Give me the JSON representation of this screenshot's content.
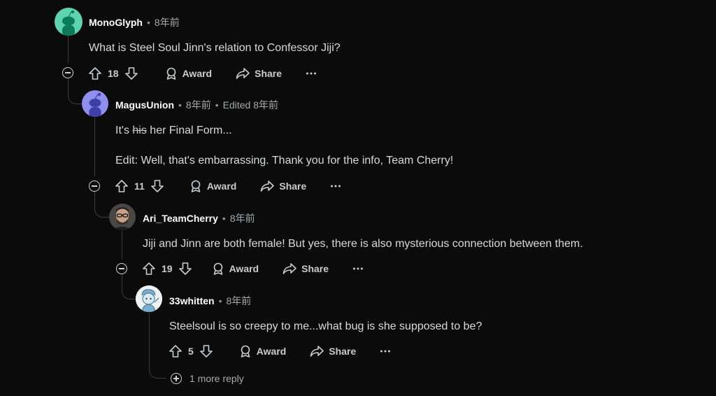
{
  "comments": [
    {
      "username": "MonoGlyph",
      "time": "8年前",
      "body": "What is Steel Soul Jinn's relation to Confessor Jiji?",
      "votes": "18",
      "award_label": "Award",
      "share_label": "Share"
    },
    {
      "username": "MagusUnion",
      "time": "8年前",
      "edited": "Edited 8年前",
      "body_prefix": "It's ",
      "body_strike": "his",
      "body_suffix": " her Final Form...",
      "body_edit": "Edit: Well, that's embarrassing. Thank you for the info, Team Cherry!",
      "votes": "11",
      "award_label": "Award",
      "share_label": "Share"
    },
    {
      "username": "Ari_TeamCherry",
      "time": "8年前",
      "body": "Jiji and Jinn are both female! But yes, there is also mysterious connection between them.",
      "votes": "19",
      "award_label": "Award",
      "share_label": "Share"
    },
    {
      "username": "33whitten",
      "time": "8年前",
      "body": "Steelsoul is so creepy to me...what bug is she supposed to be?",
      "votes": "5",
      "award_label": "Award",
      "share_label": "Share"
    }
  ],
  "more_replies": "1 more reply",
  "separator": "•",
  "colors": {
    "background": "#0b0b0b",
    "avatar_green": "#5fd3b0",
    "avatar_purple": "#8f8ff0",
    "thread_line": "#3a3d40"
  }
}
